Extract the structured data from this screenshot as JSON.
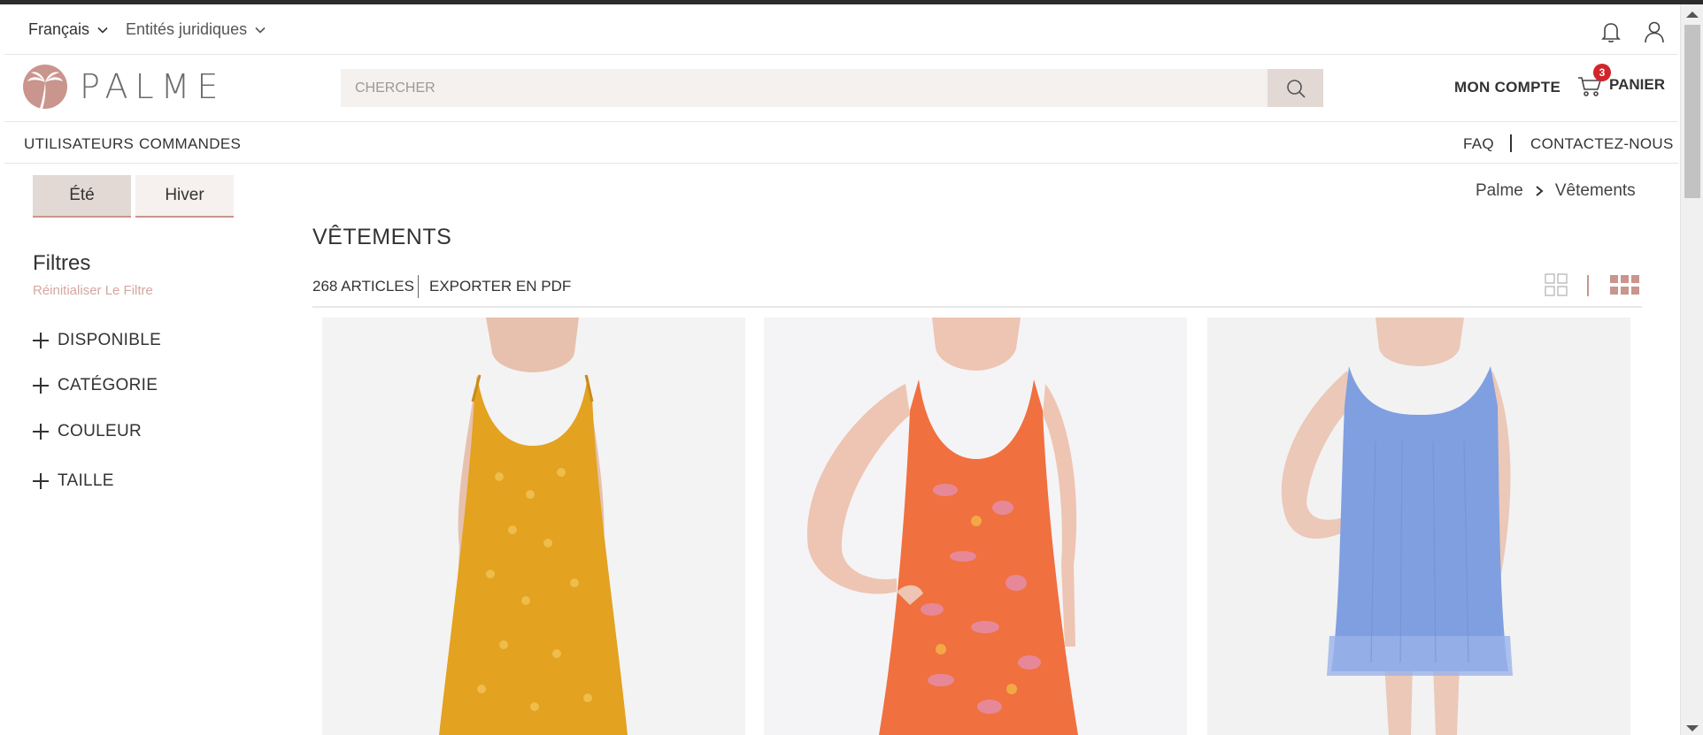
{
  "utility_bar": {
    "language": "Français",
    "legal_entities": "Entités juridiques"
  },
  "header": {
    "logo_text": "PALME",
    "search_placeholder": "CHERCHER",
    "account_label": "MON COMPTE",
    "cart_label": "PANIER",
    "cart_count": "3"
  },
  "nav": {
    "users": "UTILISATEURS",
    "orders": "COMMANDES",
    "faq": "FAQ",
    "contact": "CONTACTEZ-NOUS"
  },
  "sidebar": {
    "season_tabs": [
      "Été",
      "Hiver"
    ],
    "filters_title": "Filtres",
    "reset_filter": "Réinitialiser Le Filtre",
    "filters": [
      "DISPONIBLE",
      "CATÉGORIE",
      "COULEUR",
      "TAILLE"
    ]
  },
  "main": {
    "breadcrumb": [
      "Palme",
      "Vêtements"
    ],
    "page_title": "VÊTEMENTS",
    "article_count": "268 ARTICLES",
    "export_label": "EXPORTER EN PDF"
  },
  "products": [
    {
      "dress_color": "#e3a21f",
      "pattern_color": "#f2c65a"
    },
    {
      "dress_color": "#f0703f",
      "pattern_color": "#e58fb0"
    },
    {
      "dress_color": "#7f9fe0",
      "pattern_color": "#9ab3ea"
    }
  ],
  "colors": {
    "accent": "#c9958d",
    "cart_badge": "#d0262b",
    "search_bg": "#f5f1ef"
  }
}
